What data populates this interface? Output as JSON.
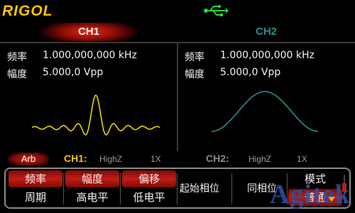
{
  "brand": "RIGOL",
  "tabs": {
    "ch1": "CH1",
    "ch2": "CH2"
  },
  "ch1": {
    "freq_label": "频率",
    "freq_value": "1.000,000,000 kHz",
    "amp_label": "幅度",
    "amp_value": "5.000,0 Vpp",
    "wave_color": "#e8d400"
  },
  "ch2": {
    "freq_label": "频率",
    "freq_value": "1.000,000,000 kHz",
    "amp_label": "幅度",
    "amp_value": "5.000,0 Vpp",
    "wave_color": "#2b8f8c"
  },
  "status": {
    "mode": "Arb",
    "ch1_label": "CH1:",
    "ch1_imp": "HighZ",
    "ch1_mult": "1X",
    "ch2_label": "CH2:",
    "ch2_imp": "HighZ",
    "ch2_mult": "1X"
  },
  "softkeys": {
    "k1_top": "频率",
    "k1_bottom": "周期",
    "k2_top": "幅度",
    "k2_bottom": "高电平",
    "k3_top": "偏移",
    "k3_bottom": "低电平",
    "k4": "起始相位",
    "k5": "同相位",
    "k6_top": "模式",
    "k6_bottom": "普通"
  },
  "watermark": "Agitek",
  "colors": {
    "accent_red": "#c11c13",
    "ch1_yellow": "#f5c400",
    "ch2_teal": "#2b8f8c",
    "usb_green": "#27d23a"
  },
  "icons": {
    "usb": "usb-icon",
    "more": "down-arrow-icon"
  }
}
